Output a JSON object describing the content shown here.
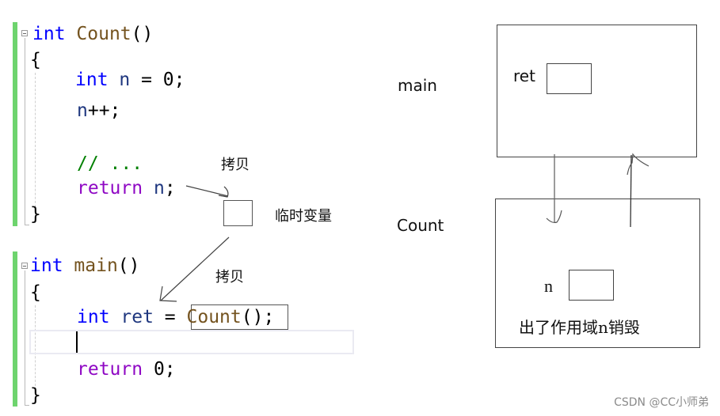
{
  "code": {
    "lines": [
      {
        "tokens": [
          {
            "t": "int",
            "c": "kw"
          },
          {
            "t": " ",
            "c": "punc"
          },
          {
            "t": "Count",
            "c": "fn"
          },
          {
            "t": "()",
            "c": "punc"
          }
        ]
      },
      {
        "tokens": [
          {
            "t": "{",
            "c": "punc"
          }
        ]
      },
      {
        "tokens": [
          {
            "t": "int",
            "c": "kw"
          },
          {
            "t": " ",
            "c": "punc"
          },
          {
            "t": "n",
            "c": "var"
          },
          {
            "t": " = 0;",
            "c": "punc"
          }
        ]
      },
      {
        "tokens": [
          {
            "t": "n",
            "c": "var"
          },
          {
            "t": "++;",
            "c": "punc"
          }
        ]
      },
      {
        "tokens": [
          {
            "t": "// ...",
            "c": "cmt"
          }
        ]
      },
      {
        "tokens": [
          {
            "t": "return",
            "c": "ctrl"
          },
          {
            "t": " ",
            "c": "punc"
          },
          {
            "t": "n",
            "c": "var"
          },
          {
            "t": ";",
            "c": "punc"
          }
        ]
      },
      {
        "tokens": [
          {
            "t": "}",
            "c": "punc"
          }
        ]
      },
      {
        "tokens": [
          {
            "t": "int",
            "c": "kw"
          },
          {
            "t": " ",
            "c": "punc"
          },
          {
            "t": "main",
            "c": "fn"
          },
          {
            "t": "()",
            "c": "punc"
          }
        ]
      },
      {
        "tokens": [
          {
            "t": "{",
            "c": "punc"
          }
        ]
      },
      {
        "tokens": [
          {
            "t": "int",
            "c": "kw"
          },
          {
            "t": " ",
            "c": "punc"
          },
          {
            "t": "ret",
            "c": "var"
          },
          {
            "t": " = ",
            "c": "punc"
          },
          {
            "t": "Count",
            "c": "fn"
          },
          {
            "t": "();",
            "c": "punc"
          }
        ]
      },
      {
        "tokens": [
          {
            "t": "return",
            "c": "ctrl"
          },
          {
            "t": " 0;",
            "c": "punc"
          }
        ]
      },
      {
        "tokens": [
          {
            "t": "}",
            "c": "punc"
          }
        ]
      }
    ]
  },
  "annotations": {
    "copy_label_1": "拷贝",
    "copy_label_2": "拷贝",
    "temp_variable_label": "临时变量"
  },
  "diagram": {
    "main_frame_label": "main",
    "count_frame_label": "Count",
    "ret_var_label": "ret",
    "n_var_label": "n",
    "destroy_note": "出了作用域n销毁"
  },
  "watermark": "CSDN @CC小师弟",
  "colors": {
    "keyword": "#0000ff",
    "function": "#74531f",
    "variable": "#1f377f",
    "control": "#8f08c4",
    "comment": "#008000",
    "gutter_change": "#6ed46e"
  }
}
